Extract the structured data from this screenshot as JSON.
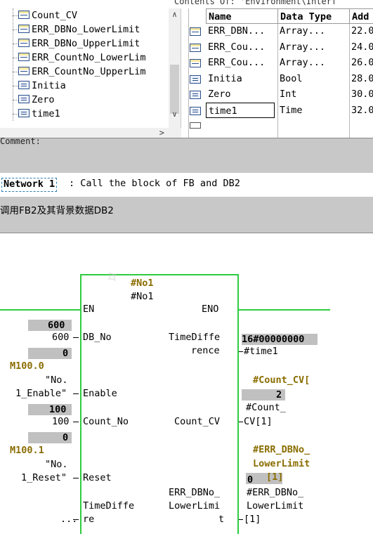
{
  "top": {
    "contents_header": "Contents Of: 'Environment\\Interf",
    "tree_items": [
      {
        "label": "Count_CV",
        "icon": "struct-icon"
      },
      {
        "label": "ERR_DBNo_LowerLimit",
        "icon": "struct-icon"
      },
      {
        "label": "ERR_DBNo_UpperLimit",
        "icon": "struct-icon"
      },
      {
        "label": "ERR_CountNo_LowerLim",
        "icon": "struct-icon"
      },
      {
        "label": "ERR_CountNo_UpperLim",
        "icon": "struct-icon"
      },
      {
        "label": "Initia",
        "icon": "variable-icon"
      },
      {
        "label": "Zero",
        "icon": "variable-icon"
      },
      {
        "label": "time1",
        "icon": "variable-icon"
      }
    ],
    "table": {
      "headers": [
        "Name",
        "Data Type",
        "Add"
      ],
      "rows": [
        {
          "name": "ERR_DBN...",
          "type": "Array...",
          "addr": "22.0",
          "icon": "struct-icon"
        },
        {
          "name": "ERR_Cou...",
          "type": "Array...",
          "addr": "24.0",
          "icon": "struct-icon"
        },
        {
          "name": "ERR_Cou...",
          "type": "Array...",
          "addr": "26.0",
          "icon": "struct-icon"
        },
        {
          "name": "Initia",
          "type": "Bool",
          "addr": "28.0",
          "icon": "variable-icon"
        },
        {
          "name": "Zero",
          "type": "Int",
          "addr": "30.0",
          "icon": "variable-icon"
        },
        {
          "name": "time1",
          "type": "Time",
          "addr": "32.0",
          "icon": "variable-icon"
        }
      ]
    }
  },
  "comment_label": "Comment:",
  "network": {
    "id": "Network 1",
    "title": ": Call the block of FB and DB2",
    "comment": "调用FB2及其背景数据DB2"
  },
  "block": {
    "instance": "#No1",
    "instance_sym": "#No1",
    "en": "EN",
    "eno": "ENO",
    "pins_left": {
      "db_no": "DB_No",
      "enable": "Enable",
      "count_no": "Count_No",
      "reset": "Reset",
      "time_diff_1": "TimeDiffe",
      "time_diff_2": "re"
    },
    "pins_right": {
      "time_difference_1": "TimeDiffe",
      "time_difference_2": "rence",
      "count_cv": "Count_CV",
      "err_dbno_1": "ERR_DBNo_",
      "err_dbno_2": "LowerLimi",
      "err_dbno_3": "t"
    },
    "inputs": {
      "db_no_value": "600",
      "db_no_param": "600",
      "zero_value_1": "0",
      "enable_addr": "M100.0",
      "enable_sym_1": "\"No.",
      "enable_sym_2": "1_Enable\"",
      "count_value": "100",
      "count_param": "100",
      "zero_value_2": "0",
      "reset_addr": "M100.1",
      "reset_sym_1": "\"No.",
      "reset_sym_2": "1_Reset\"",
      "time_diff_param": "..."
    },
    "outputs": {
      "time_value": "16#00000000",
      "time_param": "#time1",
      "count_cv_title_1": "#Count_CV[",
      "count_cv_title_2": "2",
      "count_cv_param_1": "#Count_",
      "count_cv_param_2": "CV[1]",
      "err_title_1": "#ERR_DBNo_",
      "err_title_2": "LowerLimit",
      "err_title_3": "[1]",
      "err_value": "0",
      "err_param_1": "#ERR_DBNo_",
      "err_param_2": "LowerLimit",
      "err_param_3": "[1]"
    }
  },
  "colors": {
    "rail": "#2ecc40",
    "bold_olive": "#8a6d00",
    "gray_band": "#c8c8c8"
  }
}
